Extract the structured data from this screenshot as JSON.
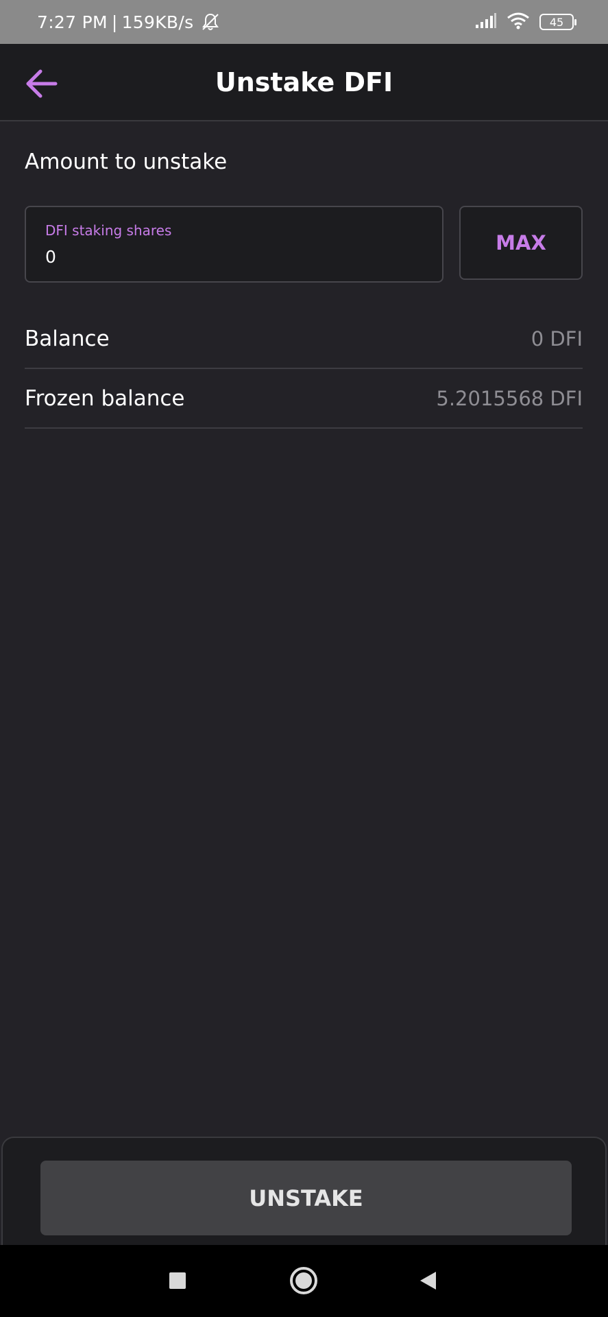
{
  "status_bar": {
    "time": "7:27 PM",
    "network_speed": "159KB/s",
    "battery_level": "45",
    "icons": [
      "bell-off-icon",
      "signal-icon",
      "wifi-icon",
      "battery-icon"
    ]
  },
  "header": {
    "title": "Unstake DFI",
    "back_icon": "arrow-left-icon"
  },
  "form": {
    "section_label": "Amount to unstake",
    "amount_field": {
      "label": "DFI staking shares",
      "value": "0"
    },
    "max_label": "MAX"
  },
  "info": {
    "balance": {
      "label": "Balance",
      "value": "0 DFI"
    },
    "frozen_balance": {
      "label": "Frozen balance",
      "value": "5.2015568 DFI"
    }
  },
  "footer": {
    "action_label": "UNSTAKE"
  },
  "nav": {
    "icons": [
      "recent-apps-icon",
      "home-icon",
      "back-triangle-icon"
    ]
  },
  "colors": {
    "background": "#232227",
    "surface": "#1c1c1f",
    "accent": "#c77ce8",
    "muted_text": "#8f8e94",
    "button_disabled": "#424245"
  }
}
